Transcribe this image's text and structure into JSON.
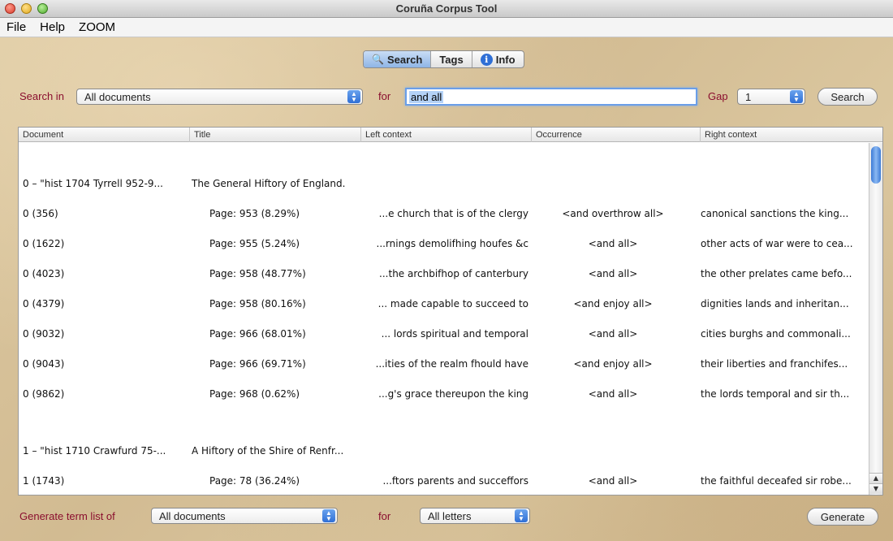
{
  "window": {
    "title": "Coruña Corpus Tool"
  },
  "menu": [
    "File",
    "Help",
    "ZOOM"
  ],
  "tabs": [
    {
      "label": "Search",
      "icon": "magnifier-icon",
      "active": true
    },
    {
      "label": "Tags",
      "active": false
    },
    {
      "label": "Info",
      "icon": "info-icon",
      "active": false
    }
  ],
  "search": {
    "search_in_label": "Search in",
    "search_in_value": "All documents",
    "for_label": "for",
    "query": "and all",
    "gap_label": "Gap",
    "gap_value": "1",
    "search_button": "Search"
  },
  "table": {
    "columns": [
      "Document",
      "Title",
      "Left context",
      "Occurrence",
      "Right context"
    ],
    "groups": [
      {
        "doc": "0 – \"hist 1704 Tyrrell 952-9...",
        "title": "The General Hiftory of England.",
        "rows": [
          {
            "doc": "0 (356)",
            "title": "Page: 953 (8.29%)",
            "left": "...e church that is of the clergy",
            "occ": "<and overthrow all>",
            "right": "canonical sanctions the king..."
          },
          {
            "doc": "0 (1622)",
            "title": "Page: 955 (5.24%)",
            "left": "...rnings demolifhing houfes &c",
            "occ": "<and all>",
            "right": "other acts of war were to cea..."
          },
          {
            "doc": "0 (4023)",
            "title": "Page: 958 (48.77%)",
            "left": "...the archbifhop of canterbury",
            "occ": "<and all>",
            "right": "the other prelates came befo..."
          },
          {
            "doc": "0 (4379)",
            "title": "Page: 958 (80.16%)",
            "left": "... made capable to succeed to",
            "occ": "<and enjoy all>",
            "right": "dignities lands and inheritan..."
          },
          {
            "doc": "0 (9032)",
            "title": "Page: 966 (68.01%)",
            "left": "... lords spiritual and temporal",
            "occ": "<and all>",
            "right": "cities burghs and commonali..."
          },
          {
            "doc": "0 (9043)",
            "title": "Page: 966 (69.71%)",
            "left": "...ities of the realm fhould have",
            "occ": "<and enjoy all>",
            "right": "their liberties and franchifes..."
          },
          {
            "doc": "0 (9862)",
            "title": "Page: 968 (0.62%)",
            "left": "...g's grace thereupon the king",
            "occ": "<and all>",
            "right": "the lords temporal and sir th..."
          }
        ]
      },
      {
        "doc": "1 – \"hist 1710 Crawfurd 75-...",
        "title": "A Hiftory of the Shire of Renfr...",
        "rows": [
          {
            "doc": "1 (1743)",
            "title": "Page: 78 (36.24%)",
            "left": "...ftors parents and succeffors",
            "occ": "<and all>",
            "right": "the faithful deceafed sir robe..."
          }
        ]
      }
    ]
  },
  "generate": {
    "label": "Generate term list of",
    "documents_value": "All documents",
    "for_label": "for",
    "letters_value": "All letters",
    "button": "Generate"
  },
  "colors": {
    "label_red": "#8a0e2e",
    "accent_blue": "#2f6fd6",
    "background": "#d9c7a3"
  }
}
